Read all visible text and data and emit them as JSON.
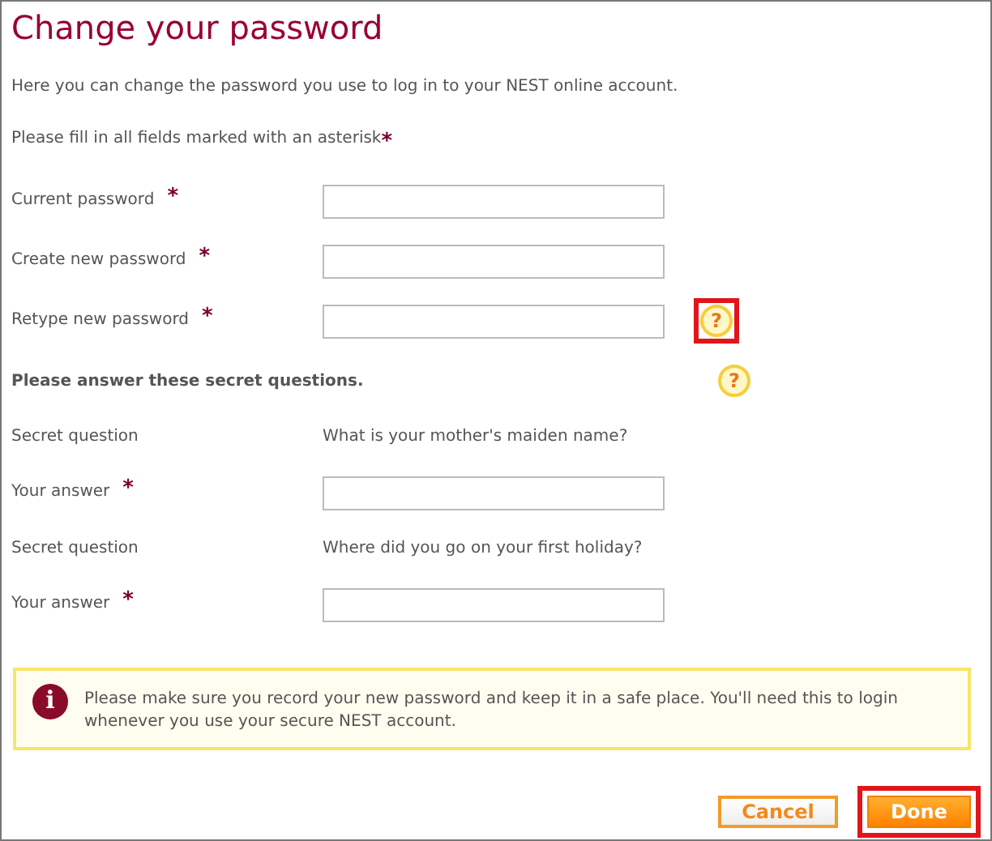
{
  "title": "Change your password",
  "intro": "Here you can change the password you use to log in to your NEST online account.",
  "required_note": {
    "text": "Please fill in all fields marked with an asterisk",
    "mark": "*"
  },
  "rows": [
    {
      "kind": "field",
      "label": "Current password",
      "mark": "*"
    },
    {
      "kind": "field",
      "label": "Create new password",
      "mark": "*"
    },
    {
      "kind": "field",
      "label": "Retype new password",
      "mark": "*",
      "help": {
        "text": "?",
        "highlighted": true
      }
    },
    {
      "kind": "heading",
      "label": "Please answer these secret questions.",
      "help": {
        "text": "?",
        "highlighted": false
      }
    },
    {
      "kind": "question",
      "label": "Secret question",
      "question": "What is your mother's maiden name?"
    },
    {
      "kind": "field",
      "label": "Your answer",
      "mark": "*"
    },
    {
      "kind": "question",
      "label": "Secret question",
      "question": "Where did you go on your first holiday?"
    },
    {
      "kind": "field",
      "label": "Your answer",
      "mark": "*"
    }
  ],
  "notice": {
    "icon": "i",
    "text": "Please make sure you record your new password and keep it in a safe place. You'll need this to login whenever you use your secure NEST account."
  },
  "buttons": [
    {
      "kind": "secondary",
      "label": "Cancel",
      "highlighted": false
    },
    {
      "kind": "primary",
      "label": "Done",
      "highlighted": true
    }
  ]
}
